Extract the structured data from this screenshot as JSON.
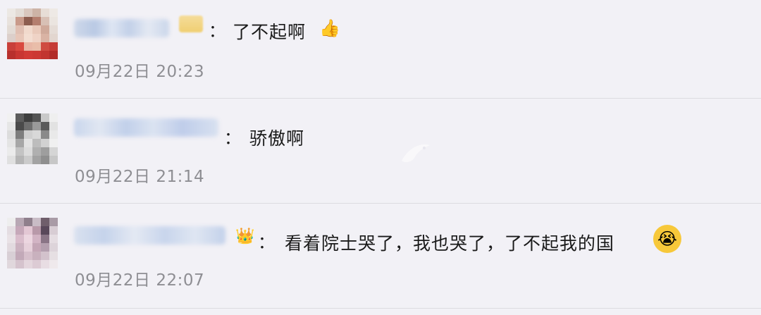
{
  "comments": [
    {
      "colon": "：",
      "text": "了不起啊",
      "emoji": "👍",
      "time": "09月22日 20:23"
    },
    {
      "colon": "：",
      "text": "骄傲啊",
      "time": "09月22日 21:14"
    },
    {
      "badge": "👑",
      "colon": "：",
      "text": "看着院士哭了，我也哭了，了不起我的国",
      "emoji": "😭",
      "time": "09月22日 22:07"
    }
  ],
  "colors": {
    "background": "#f2f1f6",
    "text": "#1a1a1a",
    "timestamp": "#8e8e93",
    "divider": "#dcdce0",
    "username_blur": "#c3d1ea"
  }
}
